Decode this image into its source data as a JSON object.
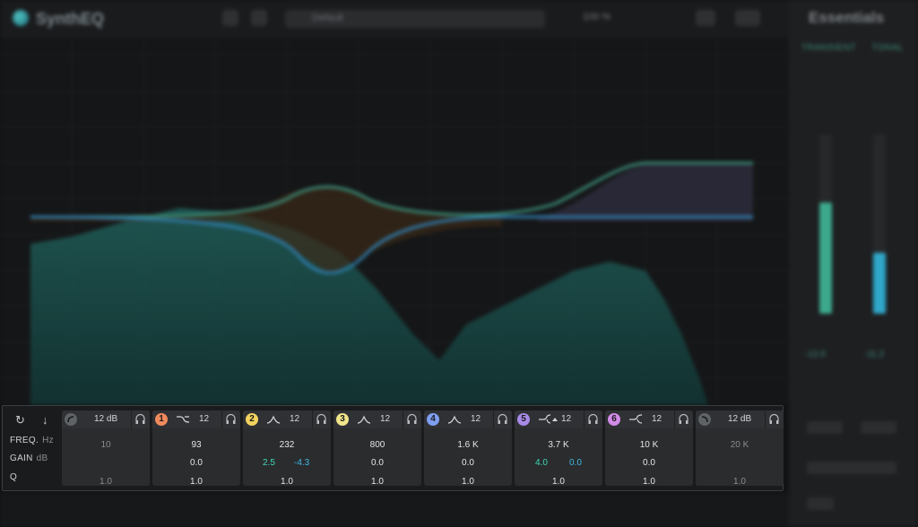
{
  "app": {
    "title": "SynthEQ"
  },
  "topbar": {
    "preset_name": "Default",
    "zoom": "100 %"
  },
  "side_panel": {
    "title": "Essentials",
    "tabs": [
      "TRANSIENT",
      "TONAL"
    ],
    "meters": [
      {
        "level": 0.62,
        "color": "#3ca98d"
      },
      {
        "level": 0.34,
        "color": "#2fa7c8"
      }
    ],
    "readouts": [
      "-12.0",
      "-11.2"
    ]
  },
  "band_panel": {
    "row_labels": {
      "freq": "FREQ.",
      "freq_unit": "Hz",
      "gain": "GAIN",
      "gain_unit": "dB",
      "q": "Q"
    },
    "bands": [
      {
        "id": "",
        "color": "",
        "shape": "low-cut",
        "slope": "12 dB",
        "freq": "10",
        "gain": "",
        "q": "1.0",
        "enabled": false
      },
      {
        "id": "1",
        "color": "#f08a5d",
        "shape": "low-shelf",
        "slope": "12",
        "freq": "93",
        "gain": "0.0",
        "q": "1.0",
        "enabled": true
      },
      {
        "id": "2",
        "color": "#f4d35e",
        "shape": "bell",
        "slope": "12",
        "freq": "232",
        "gain_a": "2.5",
        "gain_b": "-4.3",
        "q": "1.0",
        "enabled": true
      },
      {
        "id": "3",
        "color": "#f1e58c",
        "shape": "bell",
        "slope": "12",
        "freq": "800",
        "gain": "0.0",
        "q": "1.0",
        "enabled": true
      },
      {
        "id": "4",
        "color": "#7f9ef0",
        "shape": "bell",
        "slope": "12",
        "freq": "1.6 K",
        "gain": "0.0",
        "q": "1.0",
        "enabled": true
      },
      {
        "id": "5",
        "color": "#a88ae8",
        "shape": "high-shelf",
        "slope": "12",
        "freq": "3.7 K",
        "gain_a": "4.0",
        "gain_b": "0.0",
        "q": "1.0",
        "enabled": true
      },
      {
        "id": "6",
        "color": "#d28be6",
        "shape": "high-shelf",
        "slope": "12",
        "freq": "10 K",
        "gain": "0.0",
        "q": "1.0",
        "enabled": true
      },
      {
        "id": "",
        "color": "",
        "shape": "high-cut",
        "slope": "12 dB",
        "freq": "20 K",
        "gain": "",
        "q": "1.0",
        "enabled": false
      }
    ]
  },
  "graph": {
    "curve_colors": {
      "green": "#3b8d78",
      "blue": "#2f7fb1",
      "orange": "#8d5a2a"
    }
  }
}
